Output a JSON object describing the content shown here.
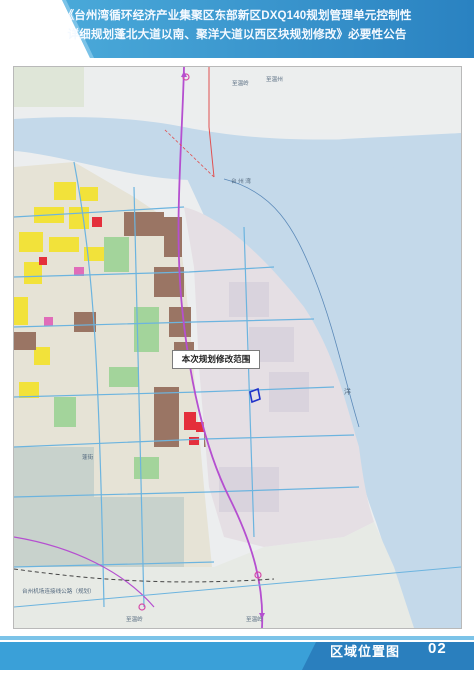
{
  "header": {
    "title_line1": "《台州湾循环经济产业集聚区东部新区DXQ140规划管理单元控制性",
    "title_line2": "详细规划蓬北大道以南、聚洋大道以西区块规划修改》必要性公告"
  },
  "map": {
    "scope_label": "本次规划修改范围",
    "places": {
      "bay": "台 州 湾",
      "sea": "洋",
      "road_north": "至温岭",
      "road_south1": "至温岭",
      "road_south2": "至温岭",
      "road_east": "至温州",
      "railway": "台州机场连接线公路（规划）",
      "district": "蓬街"
    },
    "colors": {
      "sea": "#c3d8ea",
      "land": "#e7e9ec",
      "residential": "#f4e53a",
      "commercial": "#e8302f",
      "industrial": "#9c7865",
      "green": "#9fd49a",
      "scope": "#2132c9"
    }
  },
  "footer": {
    "label": "区域位置图",
    "page_number": "02"
  }
}
